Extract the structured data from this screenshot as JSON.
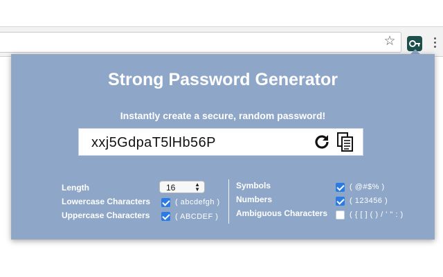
{
  "app": {
    "title": "Strong Password Generator",
    "subtitle": "Instantly create a secure, random password!",
    "password": "xxj5GdpaT5lHb56P"
  },
  "icons": {
    "toolbar": [
      "star-icon",
      "extension-key-icon",
      "menu-kebab-icon"
    ],
    "password_actions": [
      "refresh-icon",
      "copy-icon"
    ]
  },
  "colors": {
    "popup_background": "#8ea6c7",
    "checkbox_checked": "#2c7be5",
    "extension_icon_bg": "#1d4f4b"
  },
  "options": {
    "length": {
      "label": "Length",
      "value": "16"
    },
    "lowercase": {
      "label": "Lowercase Characters",
      "hint": "( abcdefgh )",
      "checked": true
    },
    "uppercase": {
      "label": "Uppercase Characters",
      "hint": "( ABCDEF )",
      "checked": true
    },
    "symbols": {
      "label": "Symbols",
      "hint": "( @#$% )",
      "checked": true
    },
    "numbers": {
      "label": "Numbers",
      "hint": "( 123456 )",
      "checked": true
    },
    "ambiguous": {
      "label": "Ambiguous Characters",
      "hint": "( { [ ] ( ) / ' \" : )",
      "checked": false
    }
  }
}
